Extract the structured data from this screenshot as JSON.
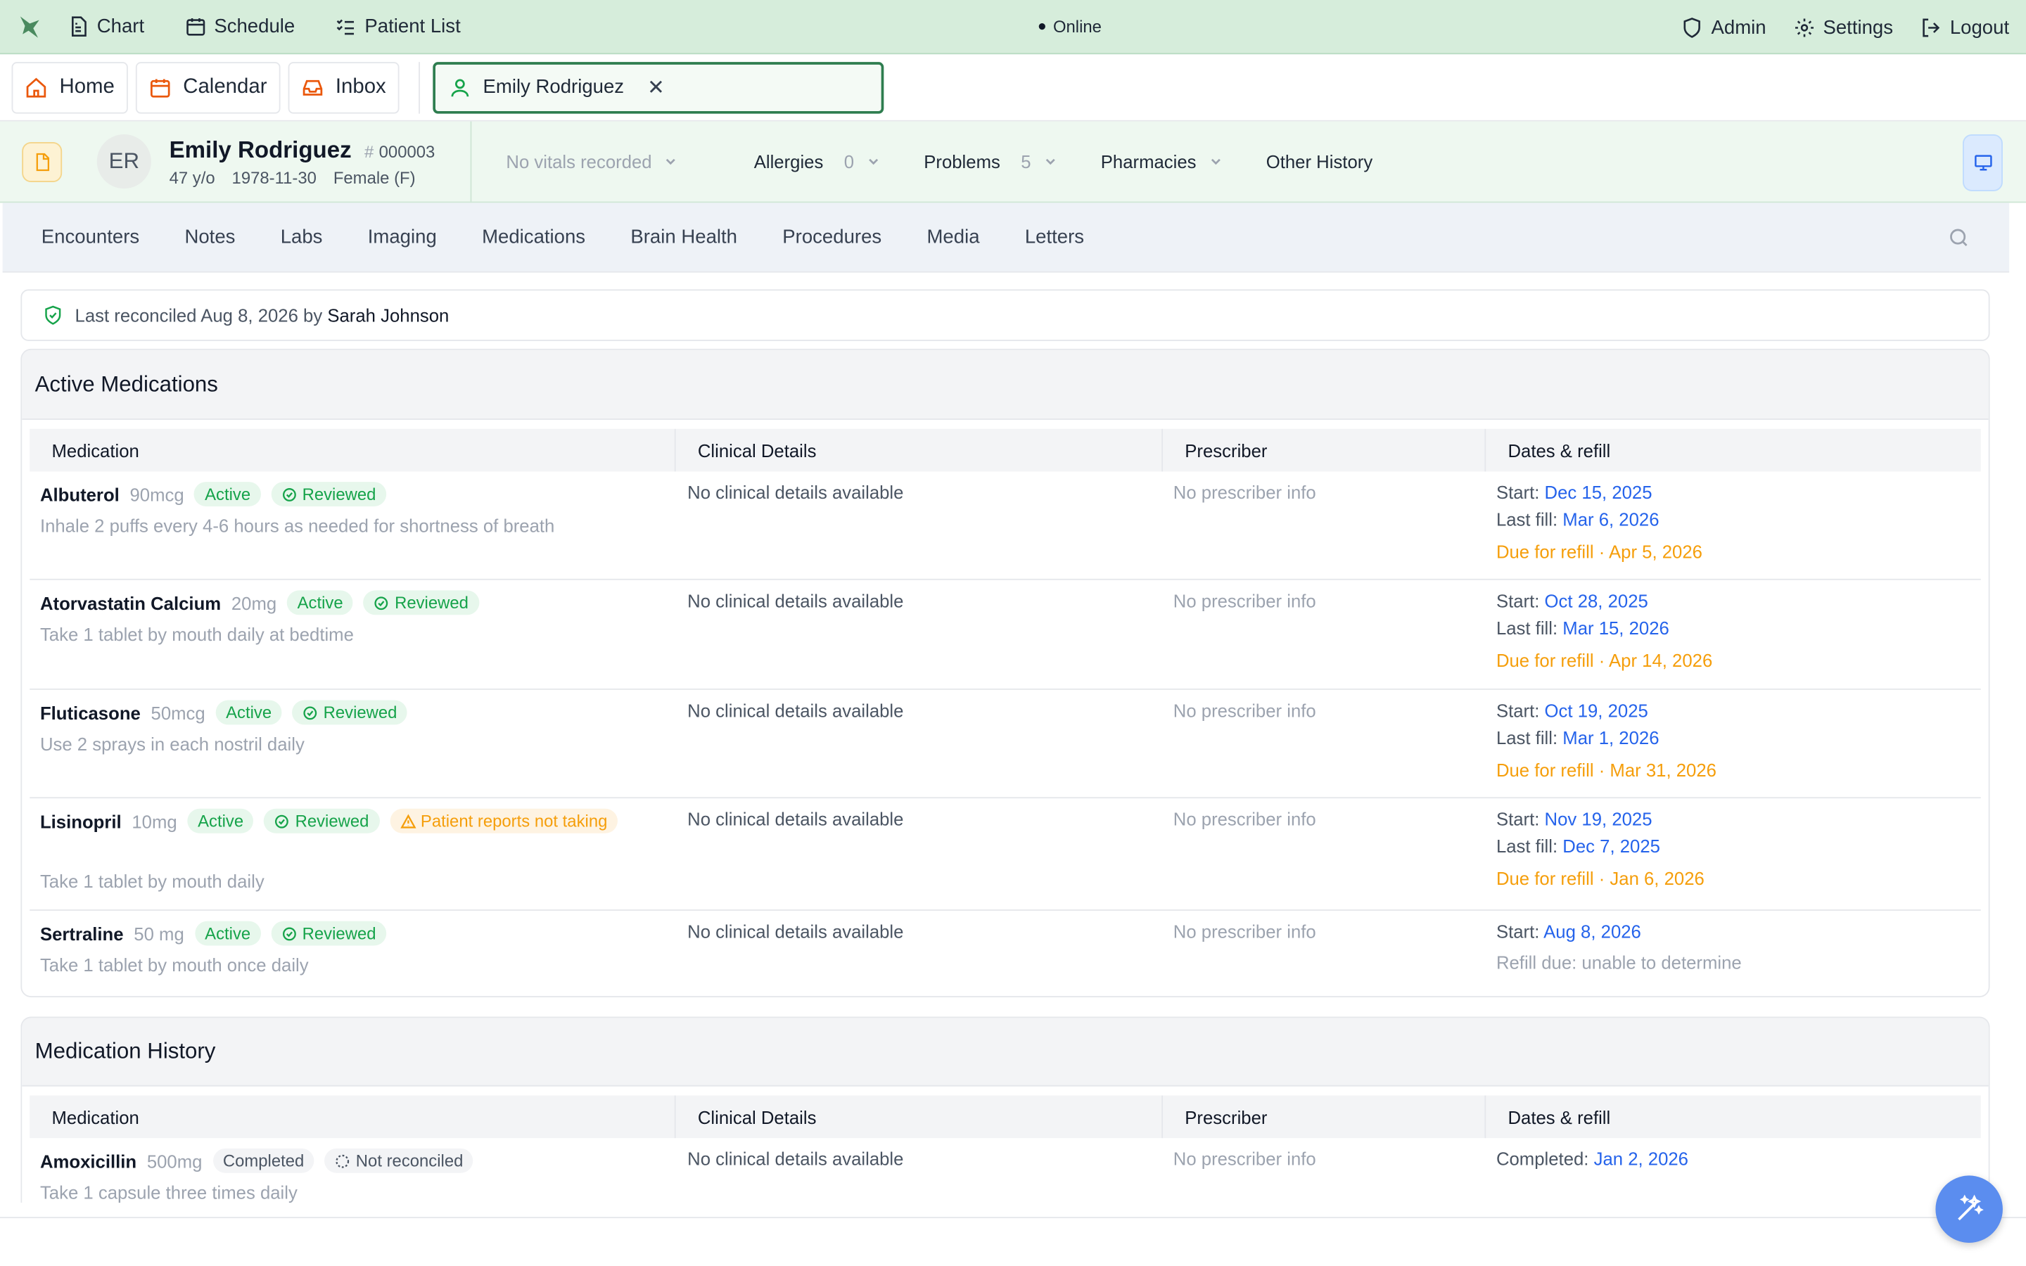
{
  "topnav": {
    "chart": "Chart",
    "schedule": "Schedule",
    "patient_list": "Patient List",
    "status": "Online",
    "admin": "Admin",
    "settings": "Settings",
    "logout": "Logout"
  },
  "tabs": {
    "home": "Home",
    "calendar": "Calendar",
    "inbox": "Inbox",
    "patient": "Emily Rodriguez"
  },
  "patient": {
    "initials": "ER",
    "name": "Emily Rodriguez",
    "id": "000003",
    "age": "47 y/o",
    "dob": "1978-11-30",
    "sex": "Female (F)",
    "vitals": "No vitals recorded",
    "allergies_label": "Allergies",
    "allergies_count": "0",
    "problems_label": "Problems",
    "problems_count": "5",
    "pharmacies_label": "Pharmacies",
    "other_history_label": "Other History"
  },
  "section_tabs": [
    "Encounters",
    "Notes",
    "Labs",
    "Imaging",
    "Medications",
    "Brain Health",
    "Procedures",
    "Media",
    "Letters"
  ],
  "reconciled": {
    "text": "Last reconciled Aug 8, 2026 by",
    "by": "Sarah Johnson"
  },
  "active_meds": {
    "title": "Active Medications",
    "headers": [
      "Medication",
      "Clinical Details",
      "Prescriber",
      "Dates & refill"
    ],
    "rows": [
      {
        "name": "Albuterol",
        "dose": "90mcg",
        "status": "Active",
        "review": "Reviewed",
        "warning": "",
        "instructions": "Inhale 2 puffs every 4-6 hours as needed for shortness of breath",
        "clinical": "No clinical details available",
        "prescriber": "No prescriber info",
        "start_label": "Start:",
        "start": "Dec 15, 2025",
        "last_fill_label": "Last fill:",
        "last_fill": "Mar 6, 2026",
        "due": "Due for refill · Apr 5, 2026"
      },
      {
        "name": "Atorvastatin Calcium",
        "dose": "20mg",
        "status": "Active",
        "review": "Reviewed",
        "warning": "",
        "instructions": "Take 1 tablet by mouth daily at bedtime",
        "clinical": "No clinical details available",
        "prescriber": "No prescriber info",
        "start_label": "Start:",
        "start": "Oct 28, 2025",
        "last_fill_label": "Last fill:",
        "last_fill": "Mar 15, 2026",
        "due": "Due for refill · Apr 14, 2026"
      },
      {
        "name": "Fluticasone",
        "dose": "50mcg",
        "status": "Active",
        "review": "Reviewed",
        "warning": "",
        "instructions": "Use 2 sprays in each nostril daily",
        "clinical": "No clinical details available",
        "prescriber": "No prescriber info",
        "start_label": "Start:",
        "start": "Oct 19, 2025",
        "last_fill_label": "Last fill:",
        "last_fill": "Mar 1, 2026",
        "due": "Due for refill · Mar 31, 2026"
      },
      {
        "name": "Lisinopril",
        "dose": "10mg",
        "status": "Active",
        "review": "Reviewed",
        "warning": "Patient reports not taking",
        "instructions": "Take 1 tablet by mouth daily",
        "clinical": "No clinical details available",
        "prescriber": "No prescriber info",
        "start_label": "Start:",
        "start": "Nov 19, 2025",
        "last_fill_label": "Last fill:",
        "last_fill": "Dec 7, 2025",
        "due": "Due for refill · Jan 6, 2026"
      },
      {
        "name": "Sertraline",
        "dose": "50 mg",
        "status": "Active",
        "review": "Reviewed",
        "warning": "",
        "instructions": "Take 1 tablet by mouth once daily",
        "clinical": "No clinical details available",
        "prescriber": "No prescriber info",
        "start_label": "Start:",
        "start": "Aug 8, 2026",
        "refill_note": "Refill due: unable to determine"
      }
    ]
  },
  "med_history": {
    "title": "Medication History",
    "headers": [
      "Medication",
      "Clinical Details",
      "Prescriber",
      "Dates & refill"
    ],
    "rows": [
      {
        "name": "Amoxicillin",
        "dose": "500mg",
        "status": "Completed",
        "review": "Not reconciled",
        "instructions": "Take 1 capsule three times daily",
        "clinical": "No clinical details available",
        "prescriber": "No prescriber info",
        "completed_label": "Completed:",
        "completed": "Jan 2, 2026"
      }
    ]
  },
  "colors": {
    "topbar_bg": "#d6eddb",
    "accent_green": "#16a34a",
    "link_blue": "#2563eb",
    "warning_orange": "#f59e0b",
    "fab_blue": "#5b8def"
  }
}
